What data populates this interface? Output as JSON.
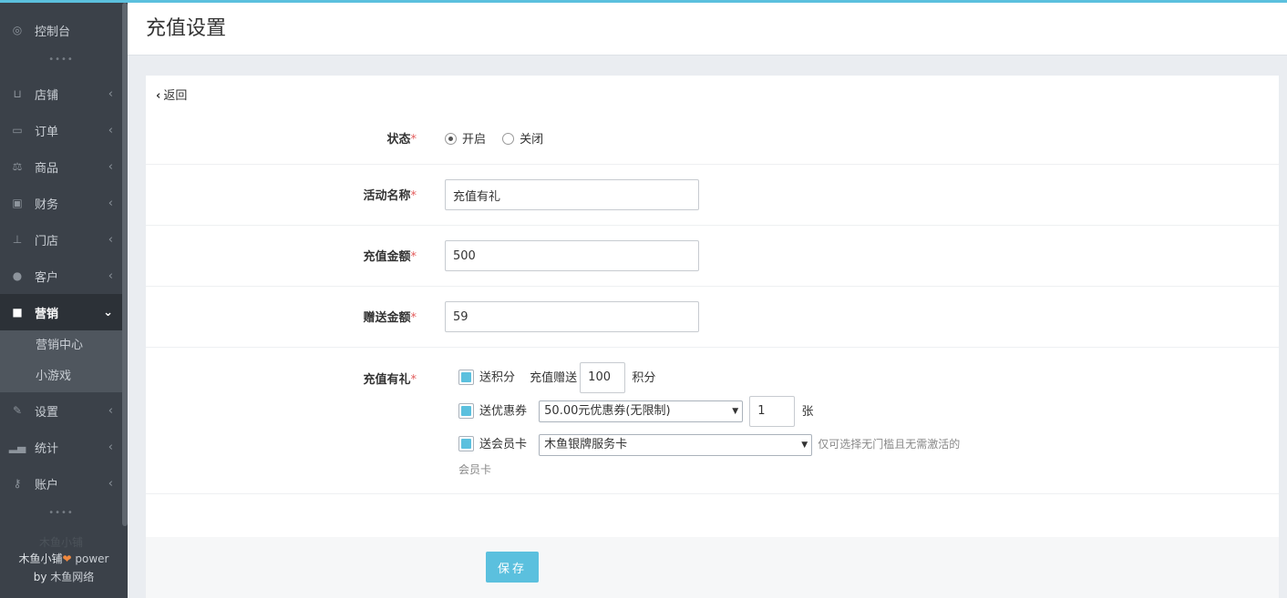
{
  "sidebar": {
    "items": [
      {
        "label": "控制台",
        "icon": "dashboard-icon"
      },
      {
        "label": "店铺",
        "icon": "basket-icon"
      },
      {
        "label": "订单",
        "icon": "order-icon"
      },
      {
        "label": "商品",
        "icon": "scale-icon"
      },
      {
        "label": "财务",
        "icon": "money-icon"
      },
      {
        "label": "门店",
        "icon": "sitemap-icon"
      },
      {
        "label": "客户",
        "icon": "users-icon"
      },
      {
        "label": "营销",
        "icon": "gift-icon"
      },
      {
        "label": "设置",
        "icon": "wrench-icon"
      },
      {
        "label": "统计",
        "icon": "signal-icon"
      },
      {
        "label": "账户",
        "icon": "key-icon"
      }
    ],
    "submenu": [
      "营销中心",
      "小游戏"
    ],
    "dots": "••••",
    "faded_text": "木鱼小铺",
    "footer": {
      "line1_a": "木鱼小铺",
      "line1_b": " power",
      "line2_a": "by ",
      "line2_b": "木鱼网络"
    }
  },
  "header": {
    "title": "充值设置"
  },
  "form": {
    "back_label": "返回",
    "status": {
      "label": "状态",
      "on_label": "开启",
      "off_label": "关闭",
      "selected": "开启"
    },
    "activity_name": {
      "label": "活动名称",
      "value": "充值有礼"
    },
    "recharge_amount": {
      "label": "充值金额",
      "value": "500"
    },
    "bonus_amount": {
      "label": "赠送金额",
      "value": "59"
    },
    "gift": {
      "label": "充值有礼",
      "points": {
        "label": "送积分",
        "prefix": "充值赠送",
        "value": "100",
        "suffix": "积分"
      },
      "coupon": {
        "label": "送优惠券",
        "selected": "50.00元优惠券(无限制)",
        "count": "1",
        "unit": "张"
      },
      "card": {
        "label": "送会员卡",
        "selected": "木鱼银牌服务卡",
        "hint_a": "仅可选择无门槛且无需激活的",
        "hint_b": "会员卡"
      }
    },
    "required_mark": "*"
  },
  "actions": {
    "save_label": "保存"
  },
  "colors": {
    "accent": "#5bc0de",
    "sidebar_bg": "#3b4149",
    "required": "#e25c5c"
  }
}
